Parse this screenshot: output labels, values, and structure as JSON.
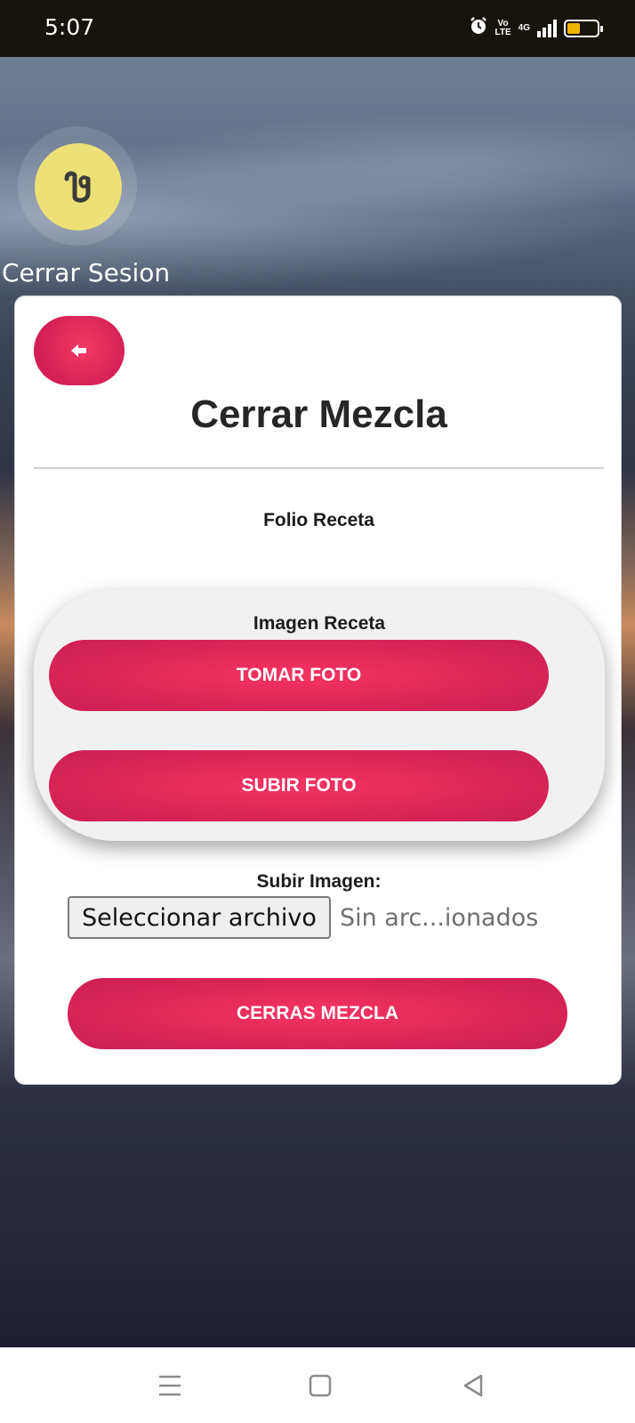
{
  "status_bar": {
    "time": "5:07",
    "network_top": "Vo",
    "network_bottom": "LTE",
    "signal_label": "4G",
    "battery_level": 0.45,
    "icons": [
      "alarm-icon",
      "volte-icon",
      "signal-icon",
      "battery-icon"
    ]
  },
  "profile": {
    "avatar_icon": "user-logo-icon",
    "avatar_color": "#ede077",
    "logout_label": "Cerrar Sesion"
  },
  "card": {
    "back_icon": "arrow-left-icon",
    "title": "Cerrar Mezcla",
    "folio_label": "Folio Receta",
    "image_section": {
      "label": "Imagen Receta",
      "take_photo_label": "TOMAR FOTO",
      "upload_photo_label": "SUBIR FOTO"
    },
    "upload_image_label": "Subir Imagen:",
    "file_button_label": "Seleccionar archivo",
    "file_status": "Sin arc...ionados",
    "close_mix_label": "CERRAS MEZCLA",
    "accent_color": "#e02a5a"
  },
  "nav_bar": {
    "icons": [
      "menu-icon",
      "home-icon",
      "back-icon"
    ]
  }
}
